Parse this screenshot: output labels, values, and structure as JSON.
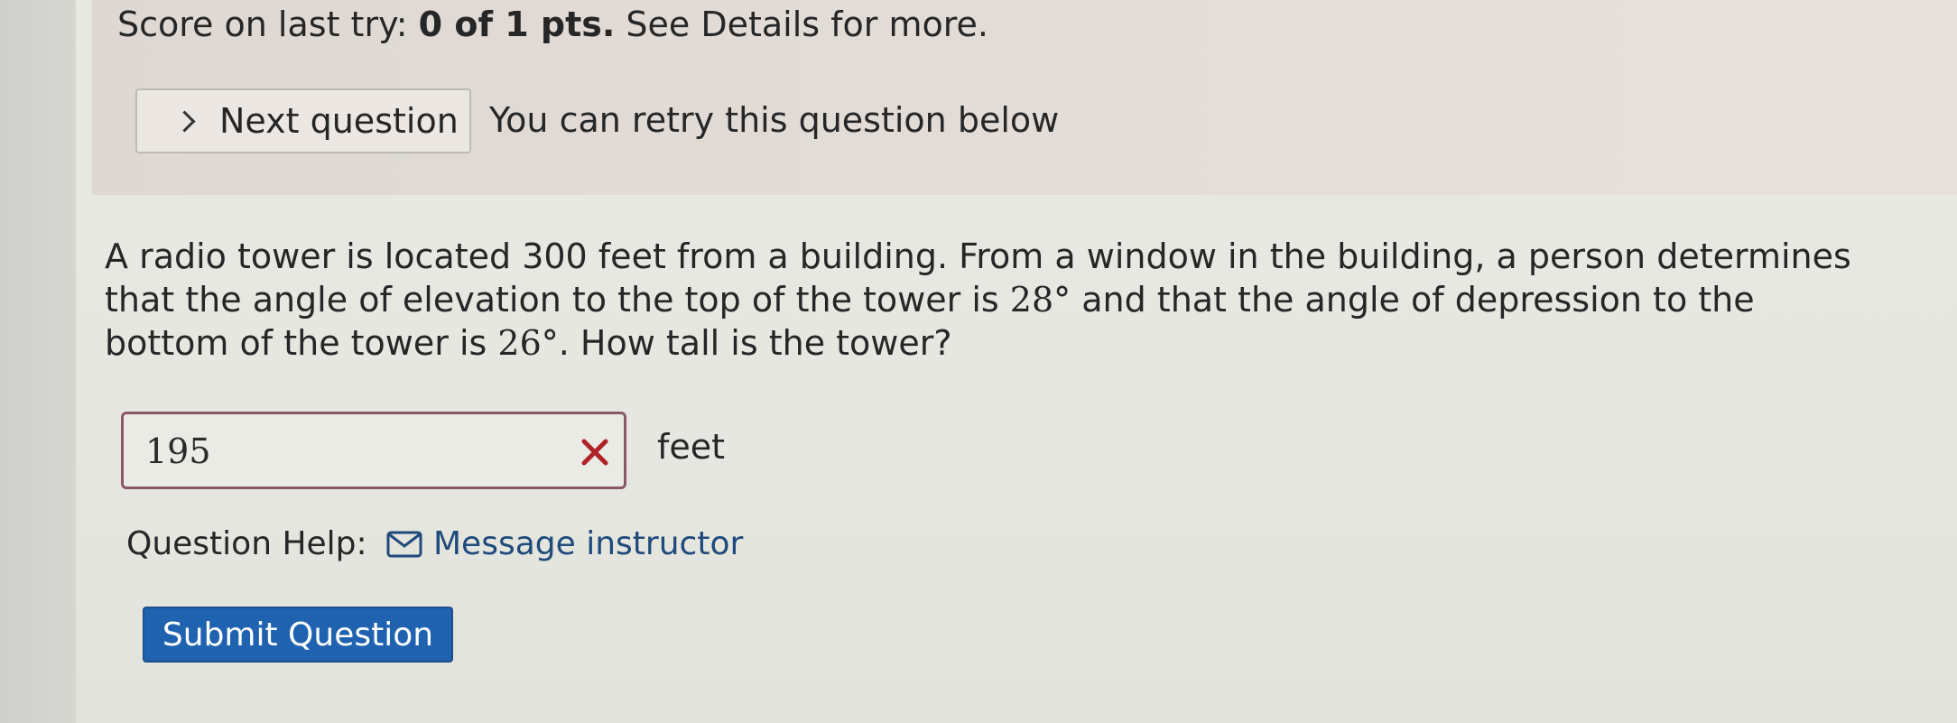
{
  "result": {
    "score_prefix": "Score on last try: ",
    "score_value": "0 of 1 pts.",
    "score_suffix": " See Details for more.",
    "next_question_label": "Next question",
    "retry_message": "You can retry this question below"
  },
  "question": {
    "text_part1": "A radio tower is located 300 feet from a building. From a window in the building, a person determines that the angle of elevation to the top of the tower is ",
    "angle_elevation": "28°",
    "text_part2": " and that the angle of depression to the bottom of the tower is ",
    "angle_depression": "26°",
    "text_part3": ". How tall is the tower?"
  },
  "answer": {
    "value": "195",
    "unit": "feet",
    "status": "incorrect"
  },
  "help": {
    "label": "Question Help:",
    "message_instructor_label": "Message instructor"
  },
  "submit": {
    "label": "Submit Question"
  },
  "colors": {
    "submit_bg": "#1f63b0",
    "link": "#1e4a7c",
    "error_x": "#b0222a",
    "answer_border": "#8a5864"
  },
  "icons": {
    "next": "chevron-right-icon",
    "clear": "close-icon",
    "message": "envelope-icon"
  }
}
